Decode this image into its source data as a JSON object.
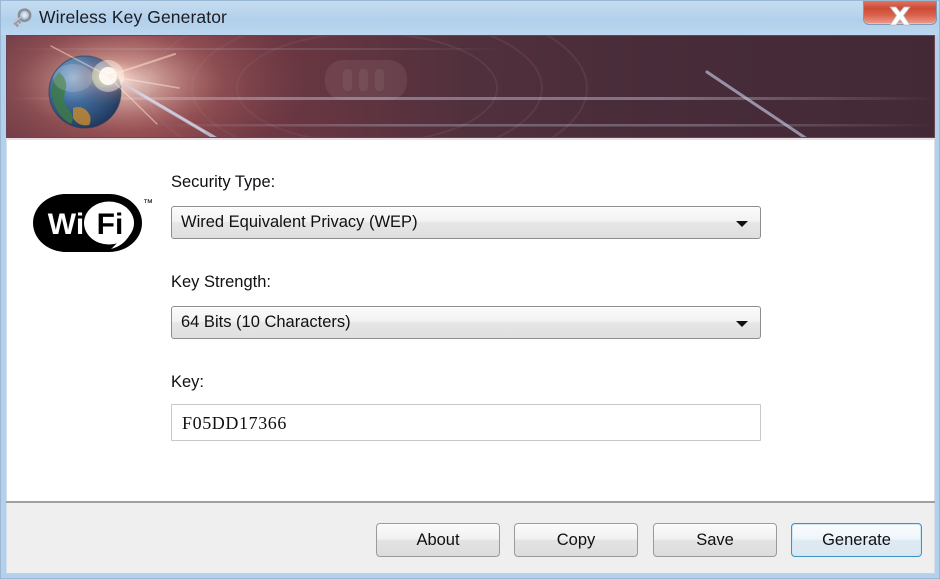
{
  "window": {
    "title": "Wireless Key Generator",
    "title_icon": "key-icon",
    "close_label": "✕"
  },
  "banner": {
    "graphic": "globe-with-lens-flare"
  },
  "logo": {
    "wifi_left": "Wi",
    "wifi_right": "Fi",
    "trademark": "™"
  },
  "form": {
    "security_type": {
      "label": "Security Type:",
      "value": "Wired Equivalent Privacy (WEP)"
    },
    "key_strength": {
      "label": "Key Strength:",
      "value": "64 Bits (10 Characters)"
    },
    "key": {
      "label": "Key:",
      "value": "F05DD17366"
    }
  },
  "buttons": {
    "about": "About",
    "copy": "Copy",
    "save": "Save",
    "generate": "Generate"
  },
  "colors": {
    "titlebar": "#b3d1ec",
    "banner": "#4a2b3a",
    "close_button": "#cd4b35",
    "default_button_border": "#3c93c8",
    "footer": "#efefef"
  }
}
